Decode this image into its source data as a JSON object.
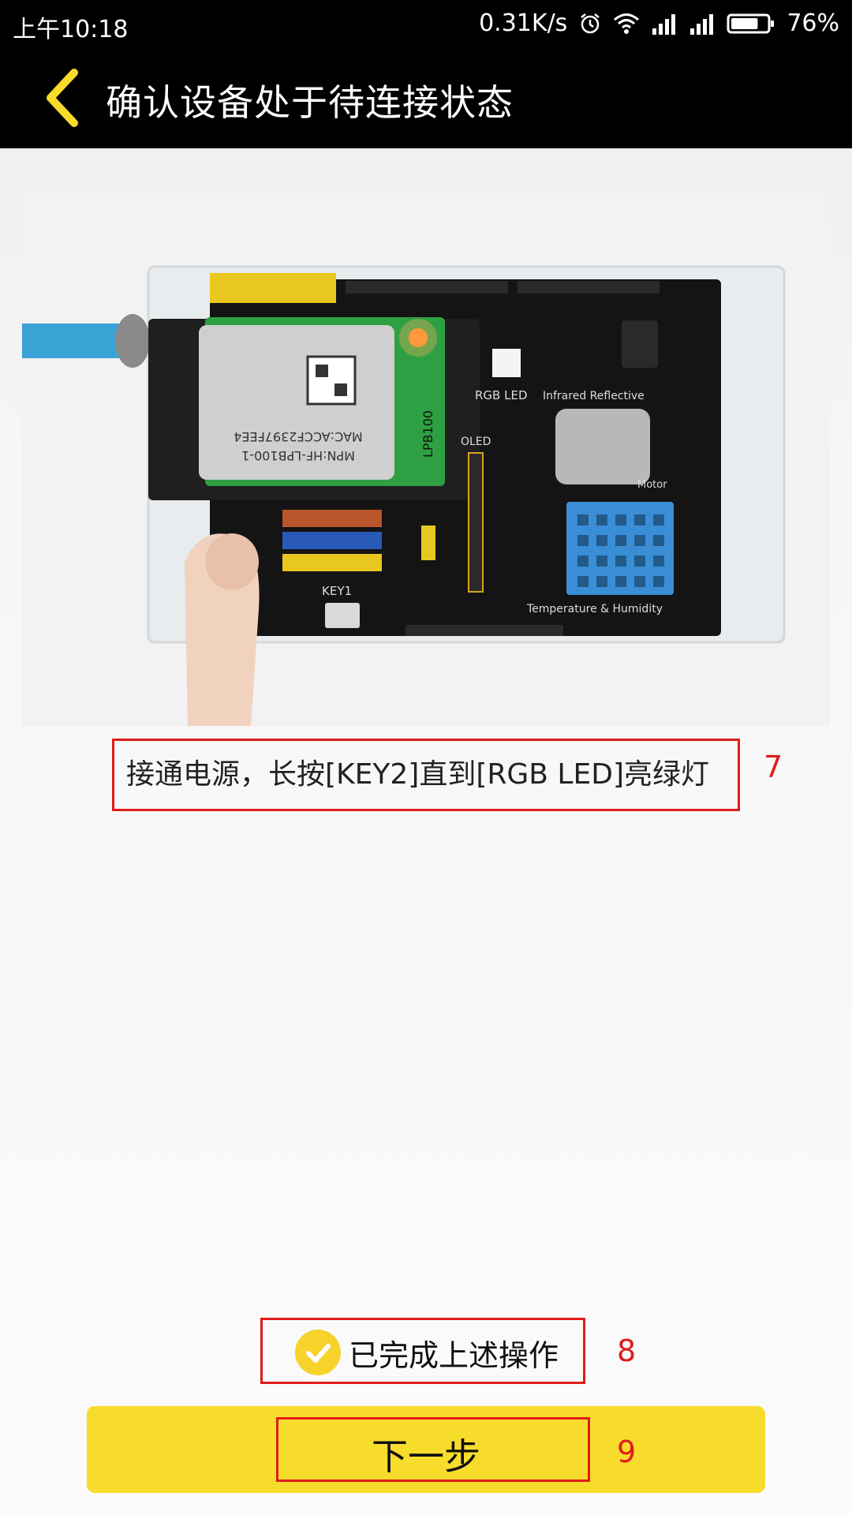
{
  "status_bar": {
    "time": "上午10:18",
    "network_speed": "0.31K/s",
    "battery_percent": "76%",
    "icons": [
      "alarm-icon",
      "wifi-icon",
      "signal-icon",
      "signal-icon",
      "battery-icon"
    ],
    "battery_level": 0.76
  },
  "header": {
    "back_icon": "chevron-left-icon",
    "title": "确认设备处于待连接状态",
    "accent_color": "#F8DC2C"
  },
  "image_labels": {
    "mpn": "MPN:HF-LPB100-1",
    "mac": "MAC:ACCF2397FEE4",
    "module": "LPB100",
    "rgb_led": "RGB LED",
    "infrared": "Infrared Reflective",
    "oled": "OLED",
    "motor": "Motor",
    "temp_humidity": "Temperature & Humidity",
    "key1": "KEY1"
  },
  "main": {
    "instruction": "接通电源，长按[KEY2]直到[RGB LED]亮绿灯",
    "instruction_annotation": "7",
    "confirm_label": "已完成上述操作",
    "confirm_checked": true,
    "confirm_annotation": "8",
    "next_button_label": "下一步",
    "next_annotation": "9"
  },
  "colors": {
    "highlight_red": "#E01B1B",
    "button_yellow": "#F8DC2C"
  }
}
